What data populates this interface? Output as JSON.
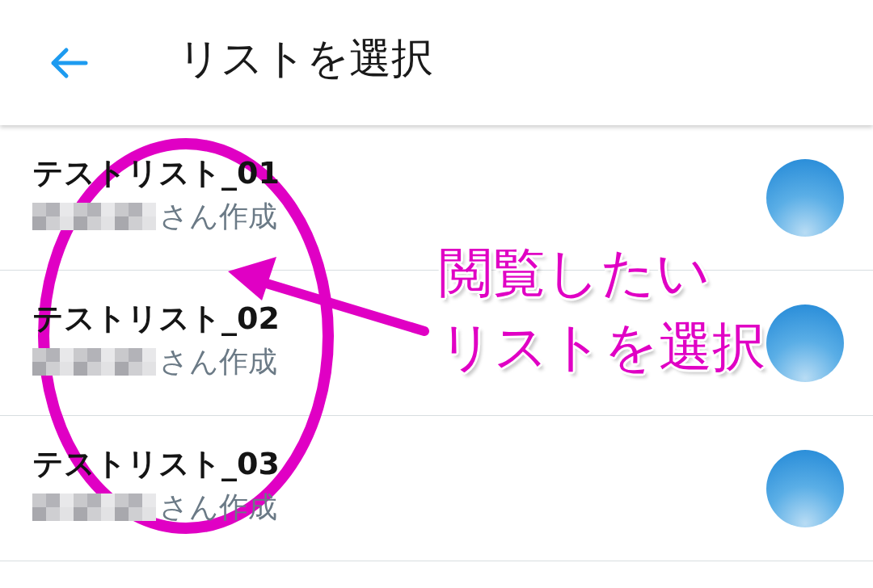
{
  "header": {
    "title": "リストを選択"
  },
  "lists": [
    {
      "name": "テストリスト_01",
      "creator_suffix": "さん作成"
    },
    {
      "name": "テストリスト_02",
      "creator_suffix": "さん作成"
    },
    {
      "name": "テストリスト_03",
      "creator_suffix": "さん作成"
    }
  ],
  "annotation": {
    "lines": [
      "閲覧したい",
      "リストを選択"
    ]
  }
}
